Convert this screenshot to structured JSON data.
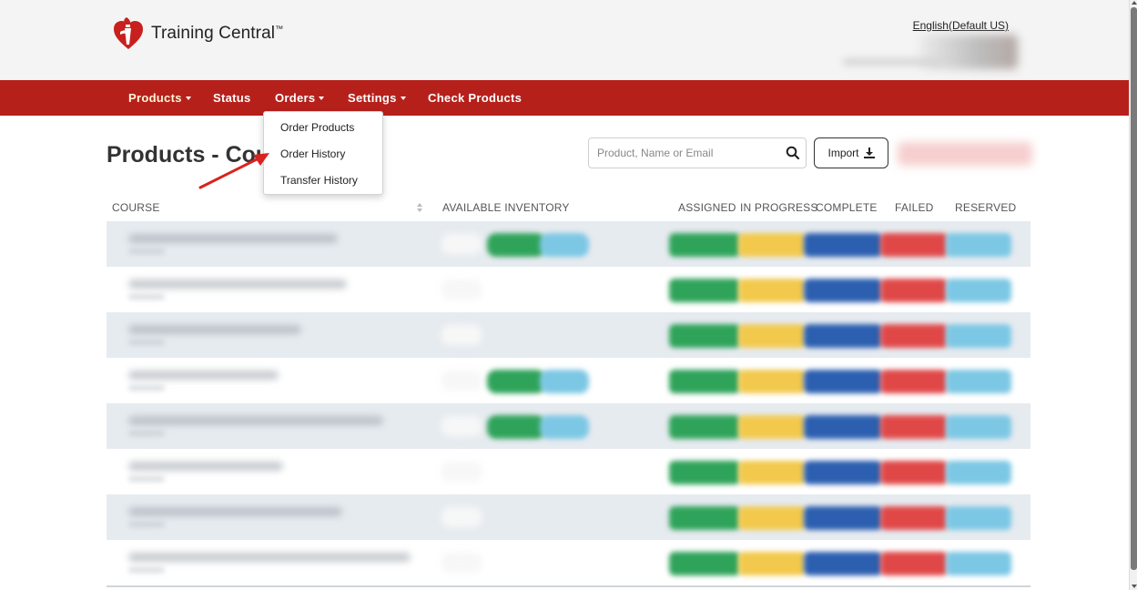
{
  "header": {
    "brand": "Training Central",
    "trademark": "™",
    "language_link": "English(Default US)"
  },
  "nav": {
    "items": [
      {
        "label": "Products",
        "has_caret": true
      },
      {
        "label": "Status",
        "has_caret": false
      },
      {
        "label": "Orders",
        "has_caret": true
      },
      {
        "label": "Settings",
        "has_caret": true
      },
      {
        "label": "Check Products",
        "has_caret": false
      }
    ]
  },
  "orders_menu": {
    "items": [
      "Order Products",
      "Order History",
      "Transfer History"
    ]
  },
  "page": {
    "title": "Products - Cours"
  },
  "search": {
    "placeholder": "Product, Name or Email",
    "value": ""
  },
  "toolbar": {
    "import_label": "Import"
  },
  "table": {
    "columns": [
      "COURSE",
      "AVAILABLE INVENTORY",
      "ASSIGNED",
      "IN PROGRESS",
      "COMPLETE",
      "FAILED",
      "RESERVED"
    ],
    "rows": [
      {
        "shaded": true,
        "inventory_bar": true
      },
      {
        "shaded": false,
        "inventory_bar": false
      },
      {
        "shaded": true,
        "inventory_bar": false
      },
      {
        "shaded": false,
        "inventory_bar": true
      },
      {
        "shaded": true,
        "inventory_bar": true
      },
      {
        "shaded": false,
        "inventory_bar": false
      },
      {
        "shaded": true,
        "inventory_bar": false
      },
      {
        "shaded": false,
        "inventory_bar": false
      }
    ]
  },
  "colors": {
    "nav_red": "#b6201b",
    "assigned": "#2fa35a",
    "in_progress": "#f2c94c",
    "complete": "#2c5fb0",
    "failed": "#e04848",
    "reserved": "#7cc7e4",
    "row_shade": "#e6ebf0"
  }
}
